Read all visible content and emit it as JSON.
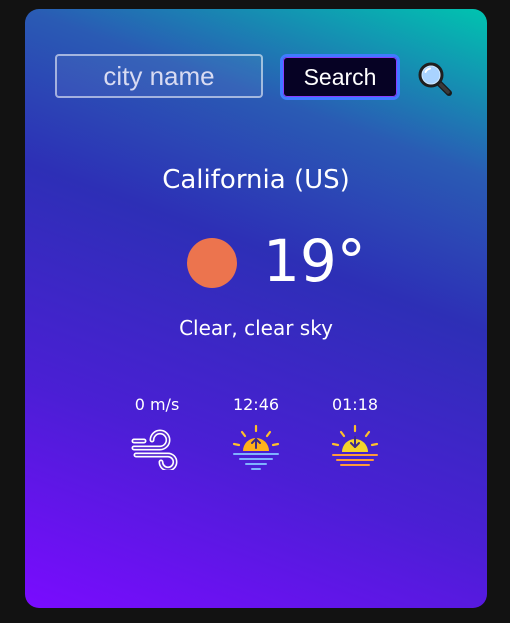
{
  "search": {
    "placeholder": "city name",
    "button_label": "Search"
  },
  "weather": {
    "location": "California (US)",
    "temperature": "19°",
    "description": "Clear, clear sky",
    "icon": "clear-sun-icon",
    "icon_color": "#ec744e"
  },
  "stats": {
    "wind": {
      "value": "0 m/s",
      "icon": "wind-icon"
    },
    "sunrise": {
      "value": "12:46",
      "icon": "sunrise-icon"
    },
    "sunset": {
      "value": "01:18",
      "icon": "sunset-icon"
    }
  },
  "colors": {
    "card_gradient_top": "#00c4b0",
    "card_gradient_mid": "#2d2fb6",
    "card_gradient_bottom": "#7a0bff",
    "button_bg": "#060224",
    "button_border": "#3f7bff"
  }
}
